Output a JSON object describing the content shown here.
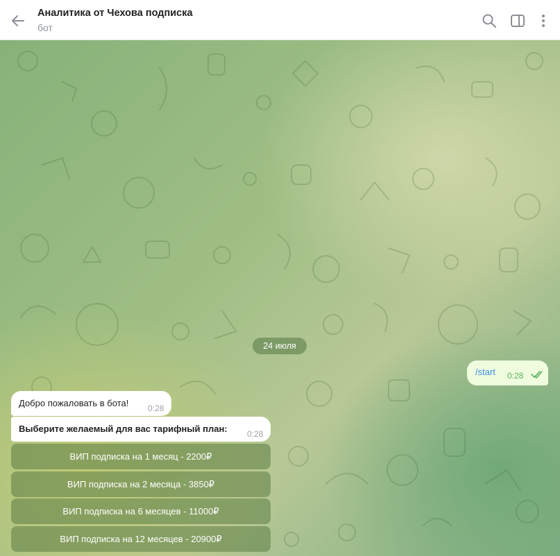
{
  "header": {
    "title": "Аналитика от Чехова подписка",
    "subtitle": "бот"
  },
  "chat": {
    "date_label": "24 июля",
    "messages": [
      {
        "direction": "out",
        "text": "/start",
        "time": "0:28",
        "status": "read"
      },
      {
        "direction": "in",
        "text": "Добро пожаловать в бота!",
        "time": "0:28"
      },
      {
        "direction": "in",
        "text": "Выберите желаемый для вас тарифный план:",
        "time": "0:28"
      }
    ],
    "keyboard": [
      "ВИП подписка на 1 месяц - 2200₽",
      "ВИП подписка на 2 месяца - 3850₽",
      "ВИП подписка на 6 месяцев - 11000₽",
      "ВИП подписка на 12 месяцев - 20900₽"
    ]
  },
  "colors": {
    "outgoing_bubble": "#effdde",
    "incoming_bubble": "#ffffff",
    "link_text": "#3a8ee6",
    "read_ticks": "#5dad5e",
    "keyboard_button": "#6c8c58"
  },
  "icons": {
    "back": "arrow-left-icon",
    "search": "search-icon",
    "sidebar": "sidebar-toggle-icon",
    "menu": "more-vertical-icon"
  }
}
